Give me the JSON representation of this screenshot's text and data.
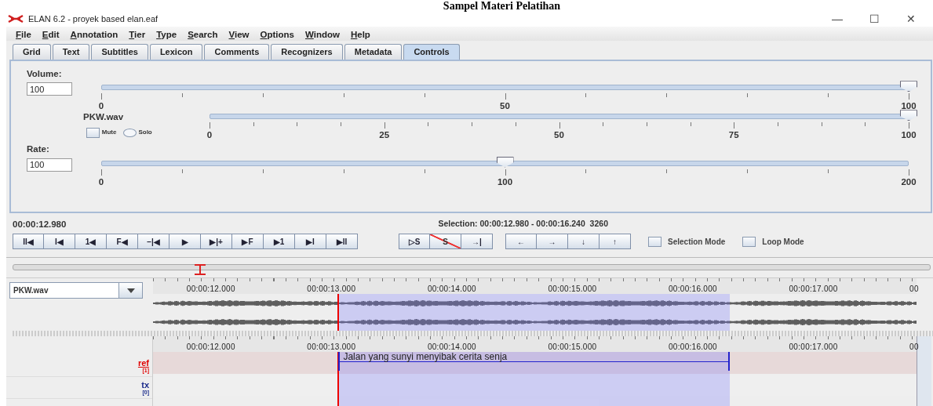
{
  "page_heading": "Sampel Materi Pelatihan",
  "window": {
    "title": "ELAN 6.2 - proyek based elan.eaf",
    "controls": [
      "—",
      "☐",
      "✕"
    ]
  },
  "menu": [
    "File",
    "Edit",
    "Annotation",
    "Tier",
    "Type",
    "Search",
    "View",
    "Options",
    "Window",
    "Help"
  ],
  "tabs": [
    {
      "label": "Grid",
      "selected": false
    },
    {
      "label": "Text",
      "selected": false
    },
    {
      "label": "Subtitles",
      "selected": false
    },
    {
      "label": "Lexicon",
      "selected": false
    },
    {
      "label": "Comments",
      "selected": false
    },
    {
      "label": "Recognizers",
      "selected": false
    },
    {
      "label": "Metadata",
      "selected": false
    },
    {
      "label": "Controls",
      "selected": true
    }
  ],
  "volume": {
    "label": "Volume:",
    "value": "100",
    "level": 1,
    "ticks": [
      "0",
      "50",
      "100"
    ]
  },
  "player": {
    "name": "PKW.wav",
    "mute": {
      "label": "Mute",
      "checked": false
    },
    "solo": {
      "label": "Solo",
      "selected": false
    },
    "level": 1,
    "ticks": [
      "0",
      "25",
      "50",
      "75",
      "100"
    ]
  },
  "rate": {
    "label": "Rate:",
    "value": "100",
    "level": 0.5,
    "ticks": [
      "0",
      "100",
      "200"
    ]
  },
  "transport": {
    "time": "00:00:12.980",
    "selection": "Selection: 00:00:12.980 - 00:00:16.240  3260",
    "play_buttons": [
      "II◀",
      "I◀",
      "1◀",
      "F◀",
      "−|◀",
      "▶",
      "▶|+",
      "▶F",
      "▶1",
      "▶I",
      "▶II"
    ],
    "selection_buttons": [
      {
        "label": "▷S",
        "struck": false
      },
      {
        "label": "S",
        "struck": true
      },
      {
        "label": "→|",
        "struck": false
      }
    ],
    "navigation_buttons": [
      "←",
      "→",
      "↓",
      "↑"
    ],
    "modes": [
      {
        "label": "Selection Mode",
        "checked": false
      },
      {
        "label": "Loop Mode",
        "checked": false
      }
    ]
  },
  "waveform": {
    "media": "PKW.wav",
    "ruler": [
      "00:00:12.000",
      "00:00:13.000",
      "00:00:14.000",
      "00:00:15.000",
      "00:00:16.000",
      "00:00:17.000",
      "00"
    ]
  },
  "timeline": {
    "ruler": [
      "00:00:12.000",
      "00:00:13.000",
      "00:00:14.000",
      "00:00:15.000",
      "00:00:16.000",
      "00:00:17.000",
      "00"
    ],
    "tiers": [
      {
        "name": "ref",
        "count": "[1]",
        "color": "#e00000",
        "annotation": "Jalan yang sunyi  menyibak cerita senja"
      },
      {
        "name": "tx",
        "count": "[0]",
        "color": "#1a2a8a"
      }
    ]
  }
}
